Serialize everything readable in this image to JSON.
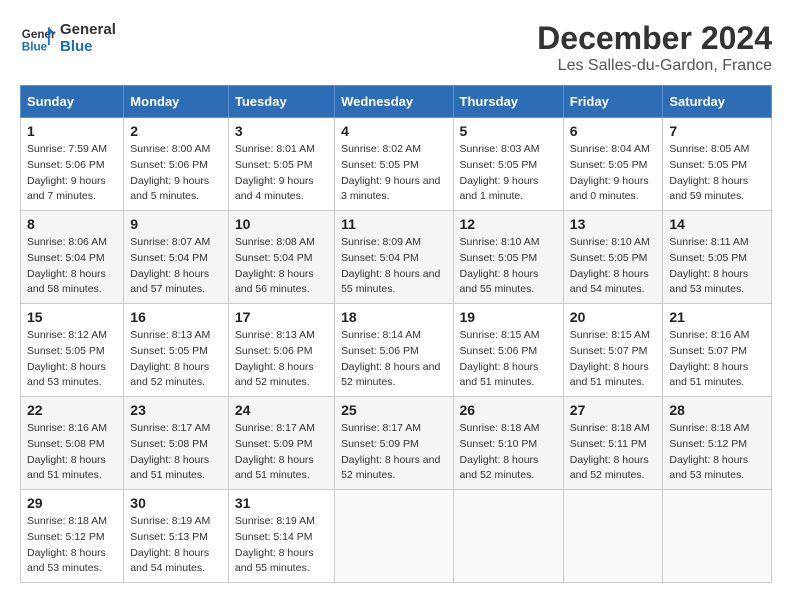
{
  "header": {
    "logo_line1": "General",
    "logo_line2": "Blue",
    "title": "December 2024",
    "subtitle": "Les Salles-du-Gardon, France"
  },
  "calendar": {
    "days_of_week": [
      "Sunday",
      "Monday",
      "Tuesday",
      "Wednesday",
      "Thursday",
      "Friday",
      "Saturday"
    ],
    "weeks": [
      [
        {
          "day": "1",
          "sunrise": "7:59 AM",
          "sunset": "5:06 PM",
          "daylight": "9 hours and 7 minutes."
        },
        {
          "day": "2",
          "sunrise": "8:00 AM",
          "sunset": "5:06 PM",
          "daylight": "9 hours and 5 minutes."
        },
        {
          "day": "3",
          "sunrise": "8:01 AM",
          "sunset": "5:05 PM",
          "daylight": "9 hours and 4 minutes."
        },
        {
          "day": "4",
          "sunrise": "8:02 AM",
          "sunset": "5:05 PM",
          "daylight": "9 hours and 3 minutes."
        },
        {
          "day": "5",
          "sunrise": "8:03 AM",
          "sunset": "5:05 PM",
          "daylight": "9 hours and 1 minute."
        },
        {
          "day": "6",
          "sunrise": "8:04 AM",
          "sunset": "5:05 PM",
          "daylight": "9 hours and 0 minutes."
        },
        {
          "day": "7",
          "sunrise": "8:05 AM",
          "sunset": "5:05 PM",
          "daylight": "8 hours and 59 minutes."
        }
      ],
      [
        {
          "day": "8",
          "sunrise": "8:06 AM",
          "sunset": "5:04 PM",
          "daylight": "8 hours and 58 minutes."
        },
        {
          "day": "9",
          "sunrise": "8:07 AM",
          "sunset": "5:04 PM",
          "daylight": "8 hours and 57 minutes."
        },
        {
          "day": "10",
          "sunrise": "8:08 AM",
          "sunset": "5:04 PM",
          "daylight": "8 hours and 56 minutes."
        },
        {
          "day": "11",
          "sunrise": "8:09 AM",
          "sunset": "5:04 PM",
          "daylight": "8 hours and 55 minutes."
        },
        {
          "day": "12",
          "sunrise": "8:10 AM",
          "sunset": "5:05 PM",
          "daylight": "8 hours and 55 minutes."
        },
        {
          "day": "13",
          "sunrise": "8:10 AM",
          "sunset": "5:05 PM",
          "daylight": "8 hours and 54 minutes."
        },
        {
          "day": "14",
          "sunrise": "8:11 AM",
          "sunset": "5:05 PM",
          "daylight": "8 hours and 53 minutes."
        }
      ],
      [
        {
          "day": "15",
          "sunrise": "8:12 AM",
          "sunset": "5:05 PM",
          "daylight": "8 hours and 53 minutes."
        },
        {
          "day": "16",
          "sunrise": "8:13 AM",
          "sunset": "5:05 PM",
          "daylight": "8 hours and 52 minutes."
        },
        {
          "day": "17",
          "sunrise": "8:13 AM",
          "sunset": "5:06 PM",
          "daylight": "8 hours and 52 minutes."
        },
        {
          "day": "18",
          "sunrise": "8:14 AM",
          "sunset": "5:06 PM",
          "daylight": "8 hours and 52 minutes."
        },
        {
          "day": "19",
          "sunrise": "8:15 AM",
          "sunset": "5:06 PM",
          "daylight": "8 hours and 51 minutes."
        },
        {
          "day": "20",
          "sunrise": "8:15 AM",
          "sunset": "5:07 PM",
          "daylight": "8 hours and 51 minutes."
        },
        {
          "day": "21",
          "sunrise": "8:16 AM",
          "sunset": "5:07 PM",
          "daylight": "8 hours and 51 minutes."
        }
      ],
      [
        {
          "day": "22",
          "sunrise": "8:16 AM",
          "sunset": "5:08 PM",
          "daylight": "8 hours and 51 minutes."
        },
        {
          "day": "23",
          "sunrise": "8:17 AM",
          "sunset": "5:08 PM",
          "daylight": "8 hours and 51 minutes."
        },
        {
          "day": "24",
          "sunrise": "8:17 AM",
          "sunset": "5:09 PM",
          "daylight": "8 hours and 51 minutes."
        },
        {
          "day": "25",
          "sunrise": "8:17 AM",
          "sunset": "5:09 PM",
          "daylight": "8 hours and 52 minutes."
        },
        {
          "day": "26",
          "sunrise": "8:18 AM",
          "sunset": "5:10 PM",
          "daylight": "8 hours and 52 minutes."
        },
        {
          "day": "27",
          "sunrise": "8:18 AM",
          "sunset": "5:11 PM",
          "daylight": "8 hours and 52 minutes."
        },
        {
          "day": "28",
          "sunrise": "8:18 AM",
          "sunset": "5:12 PM",
          "daylight": "8 hours and 53 minutes."
        }
      ],
      [
        {
          "day": "29",
          "sunrise": "8:18 AM",
          "sunset": "5:12 PM",
          "daylight": "8 hours and 53 minutes."
        },
        {
          "day": "30",
          "sunrise": "8:19 AM",
          "sunset": "5:13 PM",
          "daylight": "8 hours and 54 minutes."
        },
        {
          "day": "31",
          "sunrise": "8:19 AM",
          "sunset": "5:14 PM",
          "daylight": "8 hours and 55 minutes."
        },
        null,
        null,
        null,
        null
      ]
    ]
  }
}
